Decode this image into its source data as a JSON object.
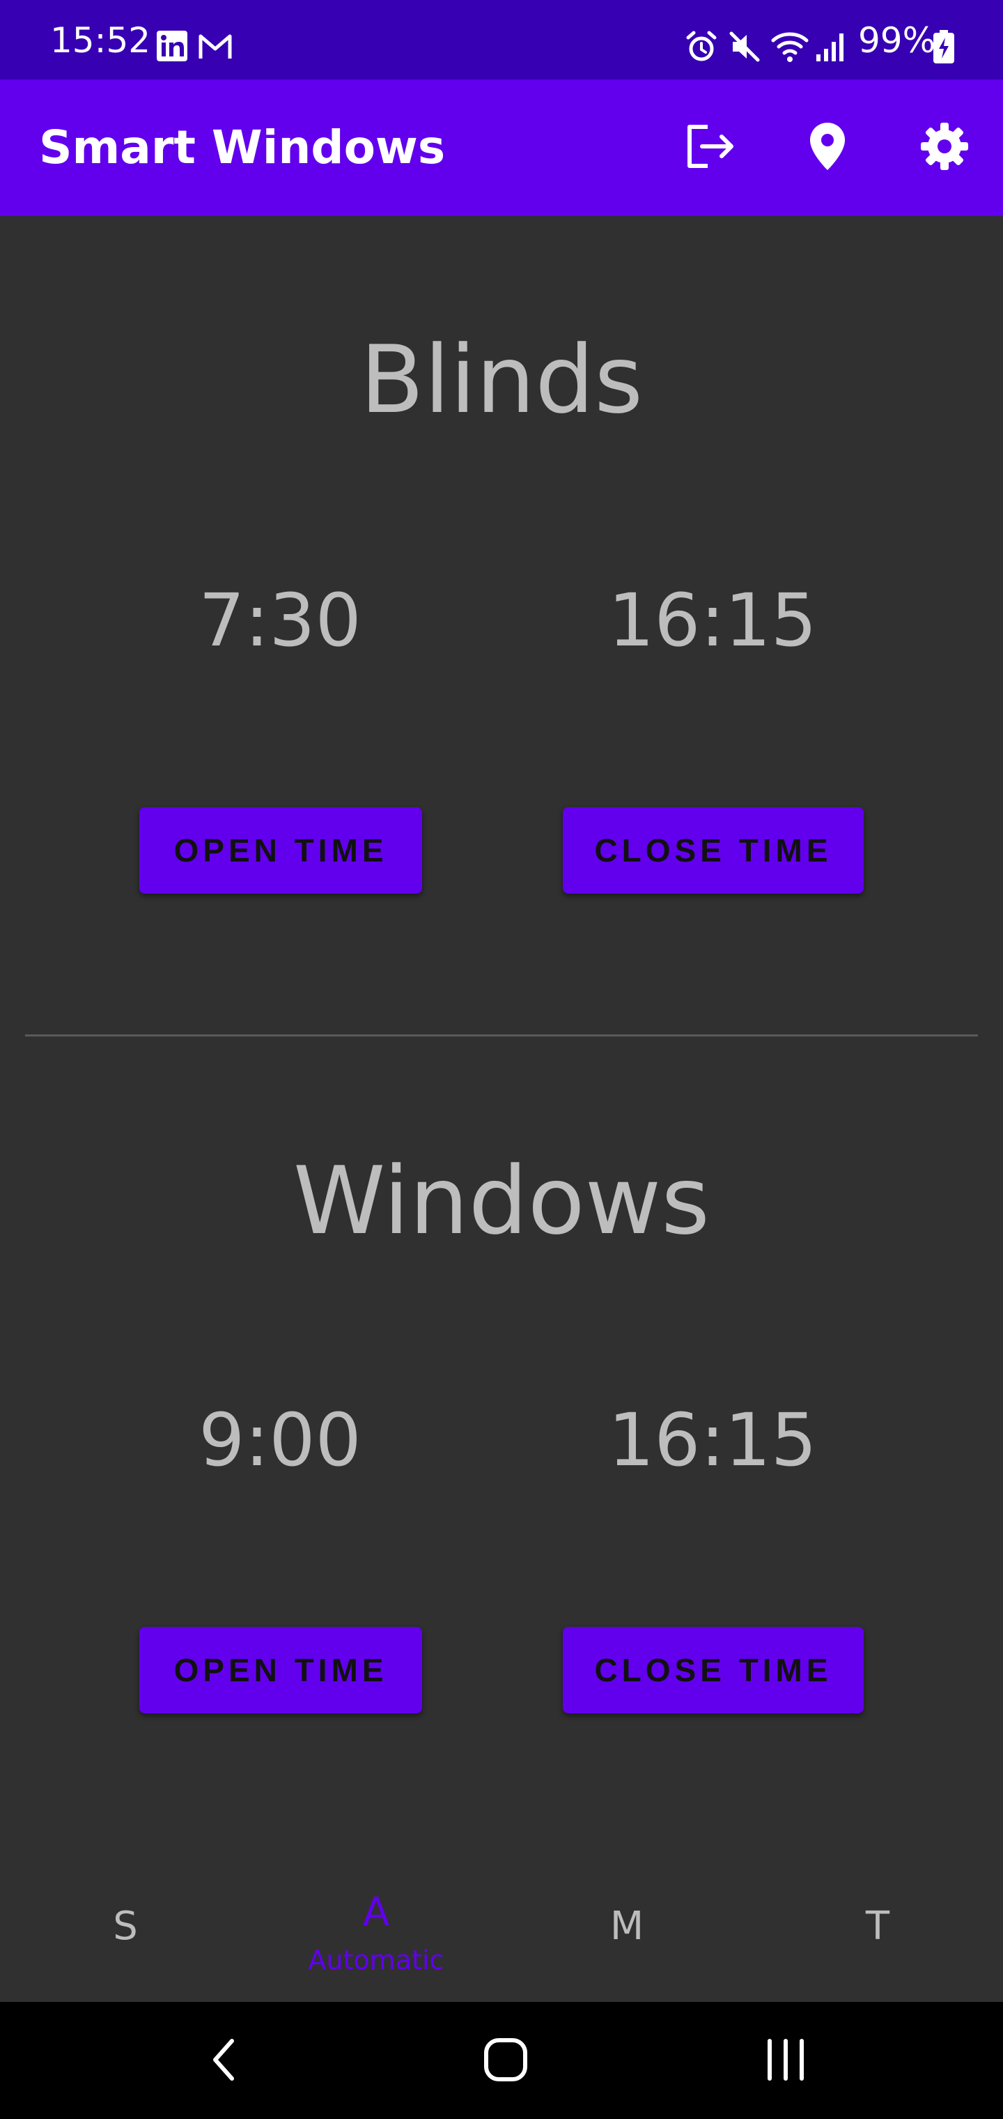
{
  "status_bar": {
    "time": "15:52",
    "battery": "99%",
    "left_icons": [
      "linkedin-icon",
      "gmail-icon"
    ],
    "right_icons": [
      "alarm-icon",
      "mute-icon",
      "wifi-icon",
      "signal-icon",
      "battery-charging-icon"
    ]
  },
  "app_bar": {
    "title": "Smart Windows",
    "actions": [
      "logout-icon",
      "location-pin-icon",
      "settings-gear-icon"
    ]
  },
  "blinds": {
    "heading": "Blinds",
    "open_time": "7:30",
    "close_time": "16:15",
    "open_button": "OPEN TIME",
    "close_button": "CLOSE TIME"
  },
  "windows": {
    "heading": "Windows",
    "open_time": "9:00",
    "close_time": "16:15",
    "open_button": "OPEN TIME",
    "close_button": "CLOSE TIME"
  },
  "bottom_nav": {
    "items": [
      {
        "letter": "S",
        "label": ""
      },
      {
        "letter": "A",
        "label": "Automatic"
      },
      {
        "letter": "M",
        "label": ""
      },
      {
        "letter": "T",
        "label": ""
      }
    ],
    "active_index": 1
  },
  "system_nav": [
    "back-icon",
    "home-icon",
    "recents-icon"
  ],
  "colors": {
    "status_bar": "#3700b3",
    "primary": "#6200ee",
    "background": "#303030",
    "text_secondary": "#bdbdbd"
  }
}
